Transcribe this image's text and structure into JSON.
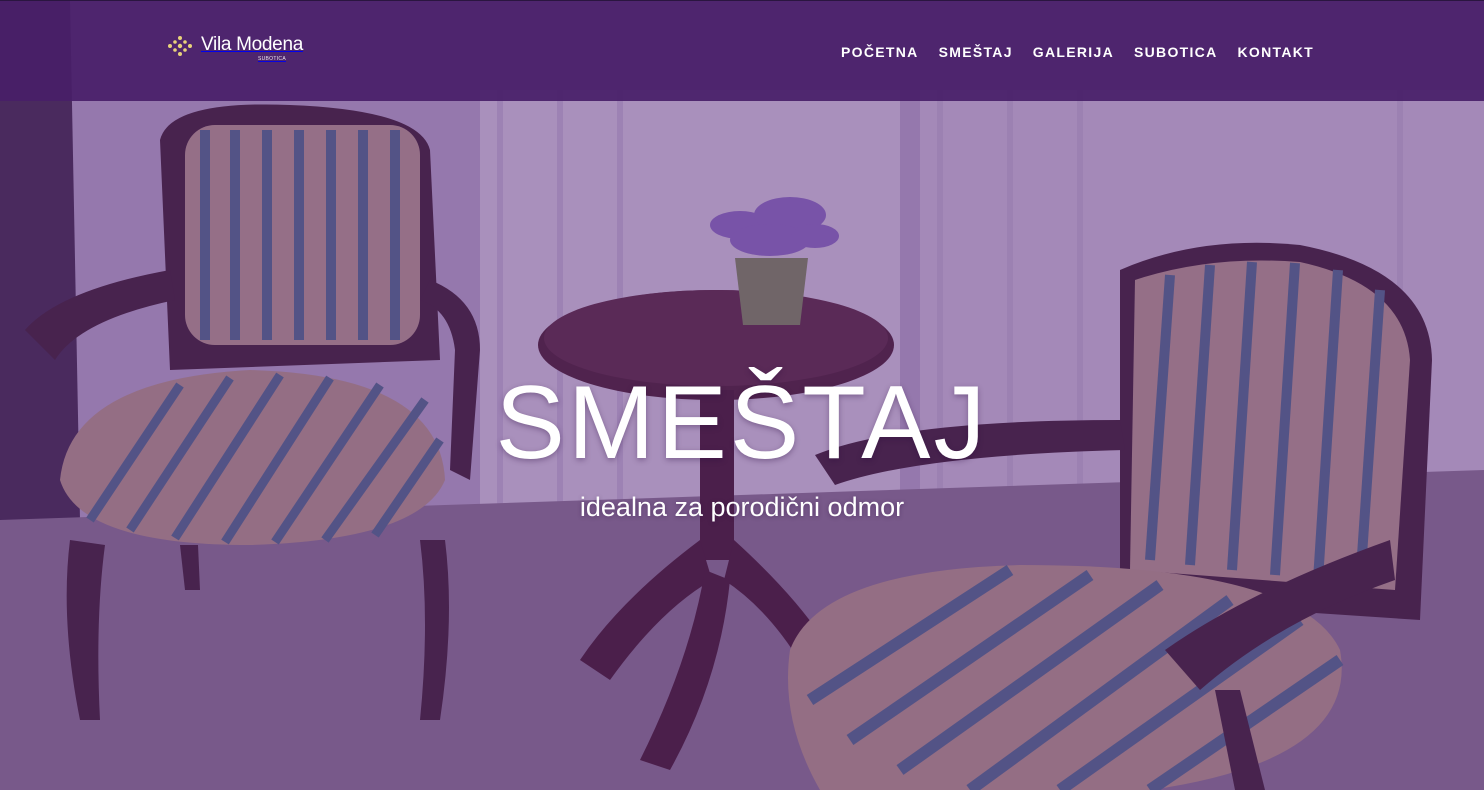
{
  "brand": {
    "name": "Vila Modena",
    "subtitle": "SUBOTICA",
    "logo_icon": "flower-dots-icon",
    "accent_color": "#e8d27a"
  },
  "nav": {
    "items": [
      {
        "label": "POČETNA"
      },
      {
        "label": "SMEŠTAJ"
      },
      {
        "label": "GALERIJA"
      },
      {
        "label": "SUBOTICA"
      },
      {
        "label": "KONTAKT"
      }
    ]
  },
  "hero": {
    "title": "SMEŠTAJ",
    "subtitle": "idealna za porodični odmor",
    "overlay_color": "#5c2b82",
    "navbar_color": "#481e68"
  }
}
